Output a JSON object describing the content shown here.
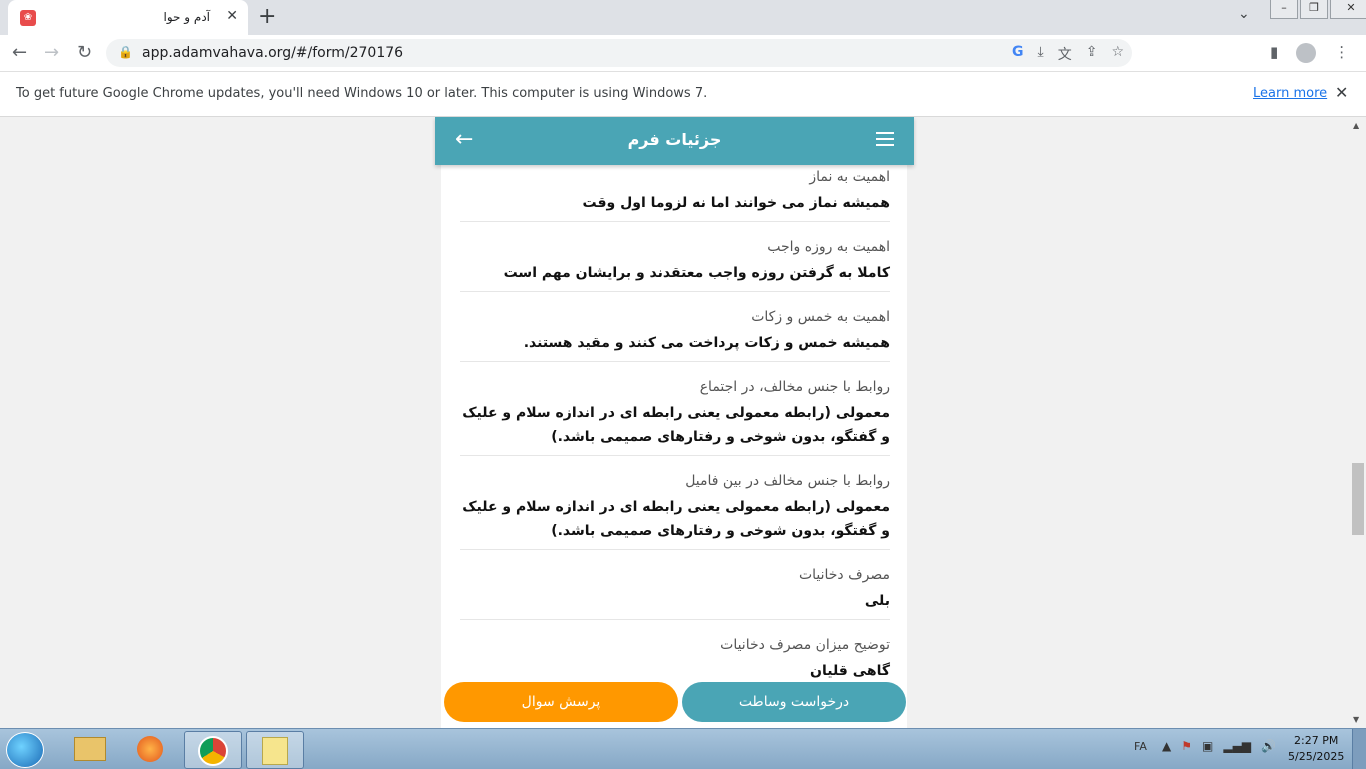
{
  "browser": {
    "tab_title": "آدم و حوا",
    "url": "app.adamvahava.org/#/form/270176",
    "infobar_text": "To get future Google Chrome updates, you'll need Windows 10 or later. This computer is using Windows 7.",
    "infobar_link": "Learn more"
  },
  "app": {
    "header_title": "جزئیات فرم",
    "fields": [
      {
        "label": "اهمیت به نماز",
        "value": "همیشه نماز می خوانند اما نه لزوما اول وقت"
      },
      {
        "label": "اهمیت به روزه واجب",
        "value": "کاملا به گرفتن روزه واجب معتقدند و برایشان مهم است"
      },
      {
        "label": "اهمیت به خمس و زکات",
        "value": "همیشه خمس و زکات پرداخت می کنند و مقید هستند."
      },
      {
        "label": "روابط با جنس مخالف، در اجتماع",
        "value": "معمولی (رابطه معمولی یعنی رابطه ای در اندازه سلام و علیک و گفتگو، بدون شوخی و رفتارهای صمیمی باشد.)"
      },
      {
        "label": "روابط با جنس مخالف در بین فامیل",
        "value": "معمولی (رابطه معمولی یعنی رابطه ای در اندازه سلام و علیک و گفتگو، بدون شوخی و رفتارهای صمیمی باشد.)"
      },
      {
        "label": "مصرف دخانیات",
        "value": "بلی"
      },
      {
        "label": "توضیح میزان مصرف دخانیات",
        "value": "گاهی قلیان"
      }
    ],
    "btn_mediation": "درخواست وساطت",
    "btn_question": "پرسش سوال"
  },
  "taskbar": {
    "lang": "FA",
    "time": "2:27 PM",
    "date": "5/25/2025"
  }
}
